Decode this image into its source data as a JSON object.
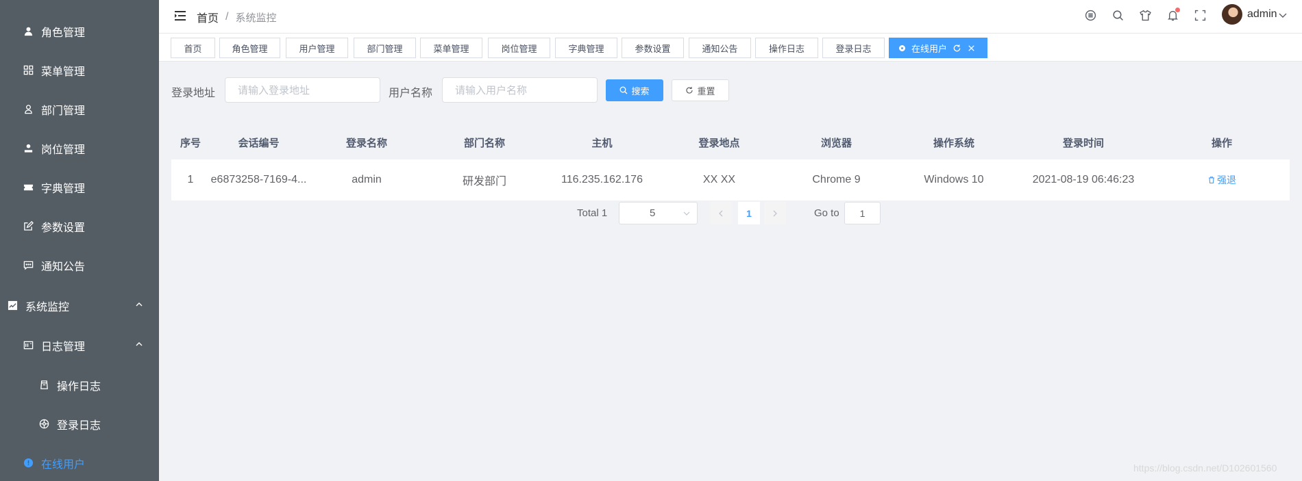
{
  "sidebar": {
    "items": [
      {
        "label": "角色管理",
        "icon": "user-icon"
      },
      {
        "label": "菜单管理",
        "icon": "grid-icon"
      },
      {
        "label": "部门管理",
        "icon": "user-outline-icon"
      },
      {
        "label": "岗位管理",
        "icon": "user-solid-icon"
      },
      {
        "label": "字典管理",
        "icon": "ticket-icon"
      },
      {
        "label": "参数设置",
        "icon": "edit-icon"
      },
      {
        "label": "通知公告",
        "icon": "chat-icon"
      },
      {
        "label": "系统监控",
        "icon": "monitor-icon"
      },
      {
        "label": "日志管理",
        "icon": "log-icon"
      },
      {
        "label": "操作日志",
        "icon": "form-icon"
      },
      {
        "label": "登录日志",
        "icon": "logininfor-icon"
      },
      {
        "label": "在线用户",
        "icon": "online-icon"
      }
    ],
    "text_color": "#ffffff",
    "active_color": "#409eff",
    "background": "#545c64"
  },
  "navbar": {
    "breadcrumb_home": "首页",
    "breadcrumb_sep": "/",
    "breadcrumb_current": "系统监控",
    "username": "admin"
  },
  "tags": {
    "items": [
      "首页",
      "角色管理",
      "用户管理",
      "部门管理",
      "菜单管理",
      "岗位管理",
      "字典管理",
      "参数设置",
      "通知公告",
      "操作日志",
      "登录日志"
    ],
    "active": "在线用户"
  },
  "search": {
    "ipaddr_label": "登录地址",
    "ipaddr_placeholder": "请输入登录地址",
    "username_label": "用户名称",
    "username_placeholder": "请输入用户名称",
    "search_label": "搜索",
    "reset_label": "重置"
  },
  "table": {
    "headers": [
      "序号",
      "会话编号",
      "登录名称",
      "部门名称",
      "主机",
      "登录地点",
      "浏览器",
      "操作系统",
      "登录时间",
      "操作"
    ],
    "rows": [
      [
        "1",
        "e6873258-7169-4...",
        "admin",
        "研发部门",
        "116.235.162.176",
        "XX XX",
        "Chrome 9",
        "Windows 10",
        "2021-08-19 06:46:23",
        "强退"
      ]
    ]
  },
  "pagination": {
    "total_text": "Total 1",
    "page_size": "5",
    "current_page": "1",
    "goto_label": "Go to",
    "goto_value": "1"
  },
  "watermark": "https://blog.csdn.net/D102601560",
  "accent_color": "#409eff"
}
